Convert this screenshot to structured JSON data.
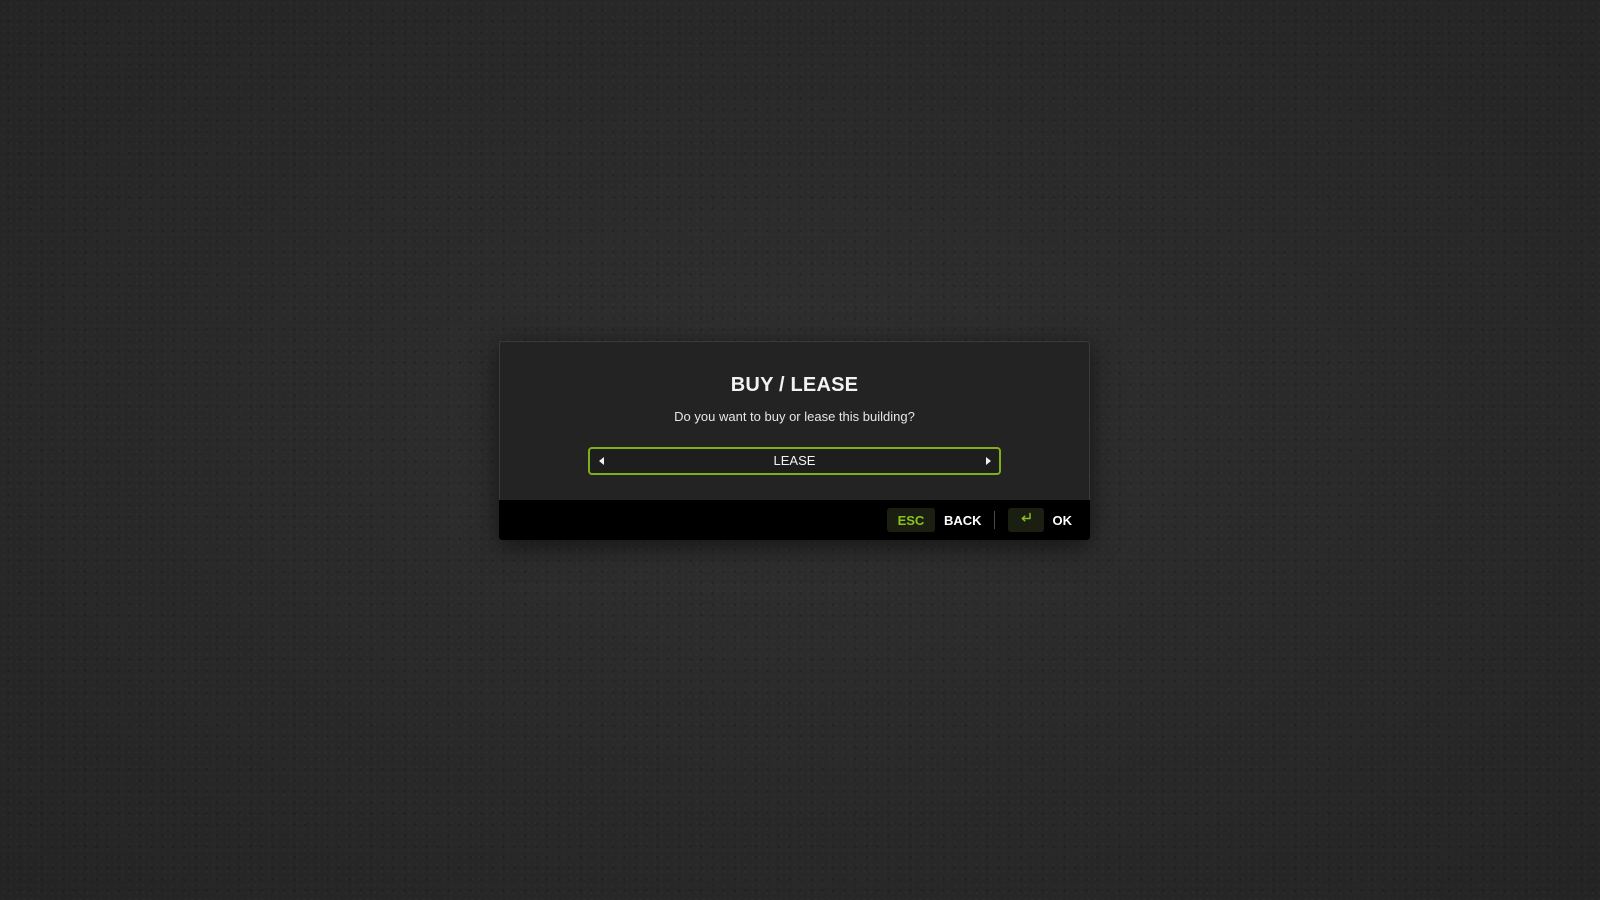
{
  "dialog": {
    "title": "BUY / LEASE",
    "message": "Do you want to buy or lease this building?",
    "selector": {
      "value": "LEASE",
      "left_arrow_icon": "triangle-left-icon",
      "right_arrow_icon": "triangle-right-icon"
    }
  },
  "footer": {
    "back": {
      "key": "ESC",
      "label": "BACK"
    },
    "ok": {
      "key_icon": "enter-key-icon",
      "label": "OK"
    }
  },
  "colors": {
    "accent": "#7fb01a",
    "key_text": "#8cc21f",
    "dialog_bg": "#232323",
    "footer_bg": "#000000"
  }
}
